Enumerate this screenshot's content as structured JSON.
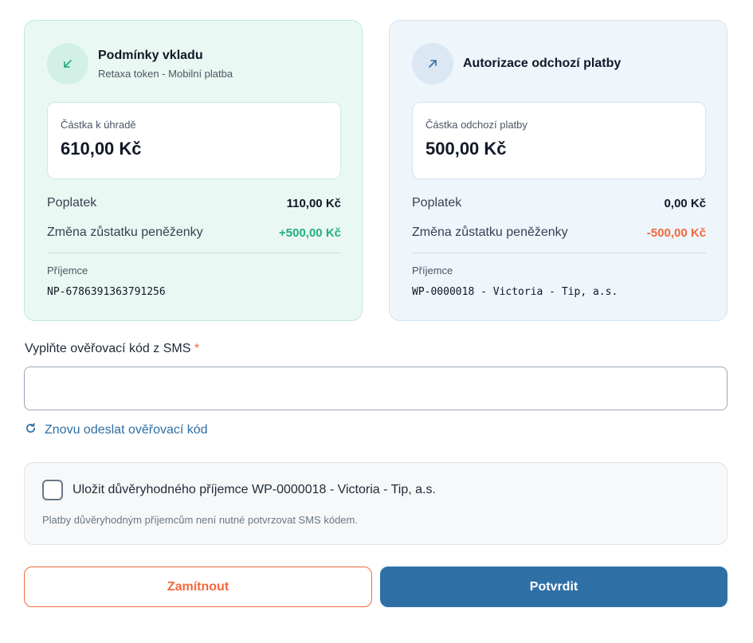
{
  "deposit": {
    "icon": "arrow-down-left-icon",
    "title": "Podmínky vkladu",
    "subtitle": "Retaxa token - Mobilní platba",
    "amount_label": "Částka k úhradě",
    "amount_value": "610,00 Kč",
    "fee_label": "Poplatek",
    "fee_value": "110,00 Kč",
    "balance_label": "Změna zůstatku peněženky",
    "balance_value": "+500,00 Kč",
    "recipient_label": "Příjemce",
    "recipient_value": "NP-6786391363791256"
  },
  "outgoing": {
    "icon": "arrow-up-right-icon",
    "title": "Autorizace odchozí platby",
    "amount_label": "Částka odchozí platby",
    "amount_value": "500,00 Kč",
    "fee_label": "Poplatek",
    "fee_value": "0,00 Kč",
    "balance_label": "Změna zůstatku peněženky",
    "balance_value": "-500,00 Kč",
    "recipient_label": "Příjemce",
    "recipient_value": "WP-0000018 - Victoria - Tip, a.s."
  },
  "sms": {
    "label": "Vyplňte ověřovací kód z SMS",
    "required_mark": "*",
    "value": "",
    "resend_icon": "refresh-icon",
    "resend_label": "Znovu odeslat ověřovací kód"
  },
  "trusted": {
    "checked": false,
    "label": "Uložit důvěryhodného příjemce WP-0000018 - Victoria - Tip, a.s.",
    "hint": "Platby důvěryhodným příjemcům není nutné potvrzovat SMS kódem."
  },
  "actions": {
    "reject_label": "Zamítnout",
    "confirm_label": "Potvrdit"
  },
  "colors": {
    "positive": "#22b07d",
    "negative": "#f2683c",
    "primary": "#2e70a6"
  }
}
